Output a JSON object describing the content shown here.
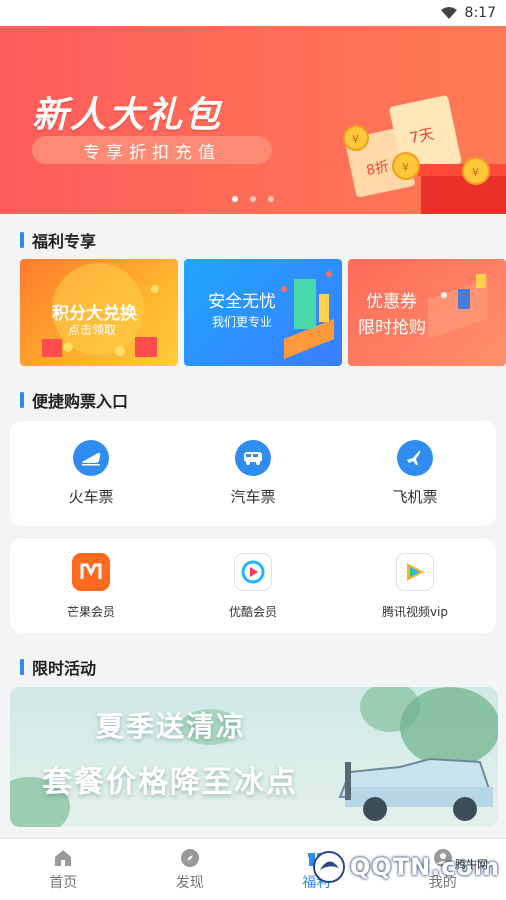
{
  "status_bar": {
    "time": "8:17"
  },
  "banner": {
    "title": "新人大礼包",
    "subtitle": "专享折扣充值",
    "coupon_texts": [
      "7天",
      "8折"
    ],
    "carousel_count": 3,
    "active_index": 0
  },
  "welfare": {
    "heading": "福利专享",
    "cards": [
      {
        "title": "积分大兑换",
        "subtitle": "点击领取"
      },
      {
        "title": "安全无忧",
        "subtitle": "我们更专业"
      },
      {
        "title": "优惠券",
        "subtitle": "限时抢购"
      }
    ]
  },
  "tickets": {
    "heading": "便捷购票入口",
    "items": [
      {
        "label": "火车票",
        "icon": "train-icon"
      },
      {
        "label": "汽车票",
        "icon": "bus-icon"
      },
      {
        "label": "飞机票",
        "icon": "plane-icon"
      }
    ]
  },
  "memberships": {
    "items": [
      {
        "label": "芒果会员",
        "icon": "mango-tv-icon"
      },
      {
        "label": "优酷会员",
        "icon": "youku-icon"
      },
      {
        "label": "腾讯视频vip",
        "icon": "tencent-video-icon"
      }
    ]
  },
  "activity": {
    "heading": "限时活动",
    "line1": "夏季送清凉",
    "line2": "套餐价格降至冰点"
  },
  "nav": {
    "items": [
      {
        "label": "首页",
        "icon": "home-icon",
        "active": false
      },
      {
        "label": "发现",
        "icon": "compass-icon",
        "active": false
      },
      {
        "label": "福利",
        "icon": "gift-icon",
        "active": true
      },
      {
        "label": "我的",
        "icon": "user-icon",
        "active": false
      }
    ]
  },
  "watermark": {
    "text": "QQTN.com",
    "small": "腾牛网"
  },
  "colors": {
    "accent": "#2f8cf0",
    "banner": "#ff6258",
    "background": "#f3f4f6"
  }
}
